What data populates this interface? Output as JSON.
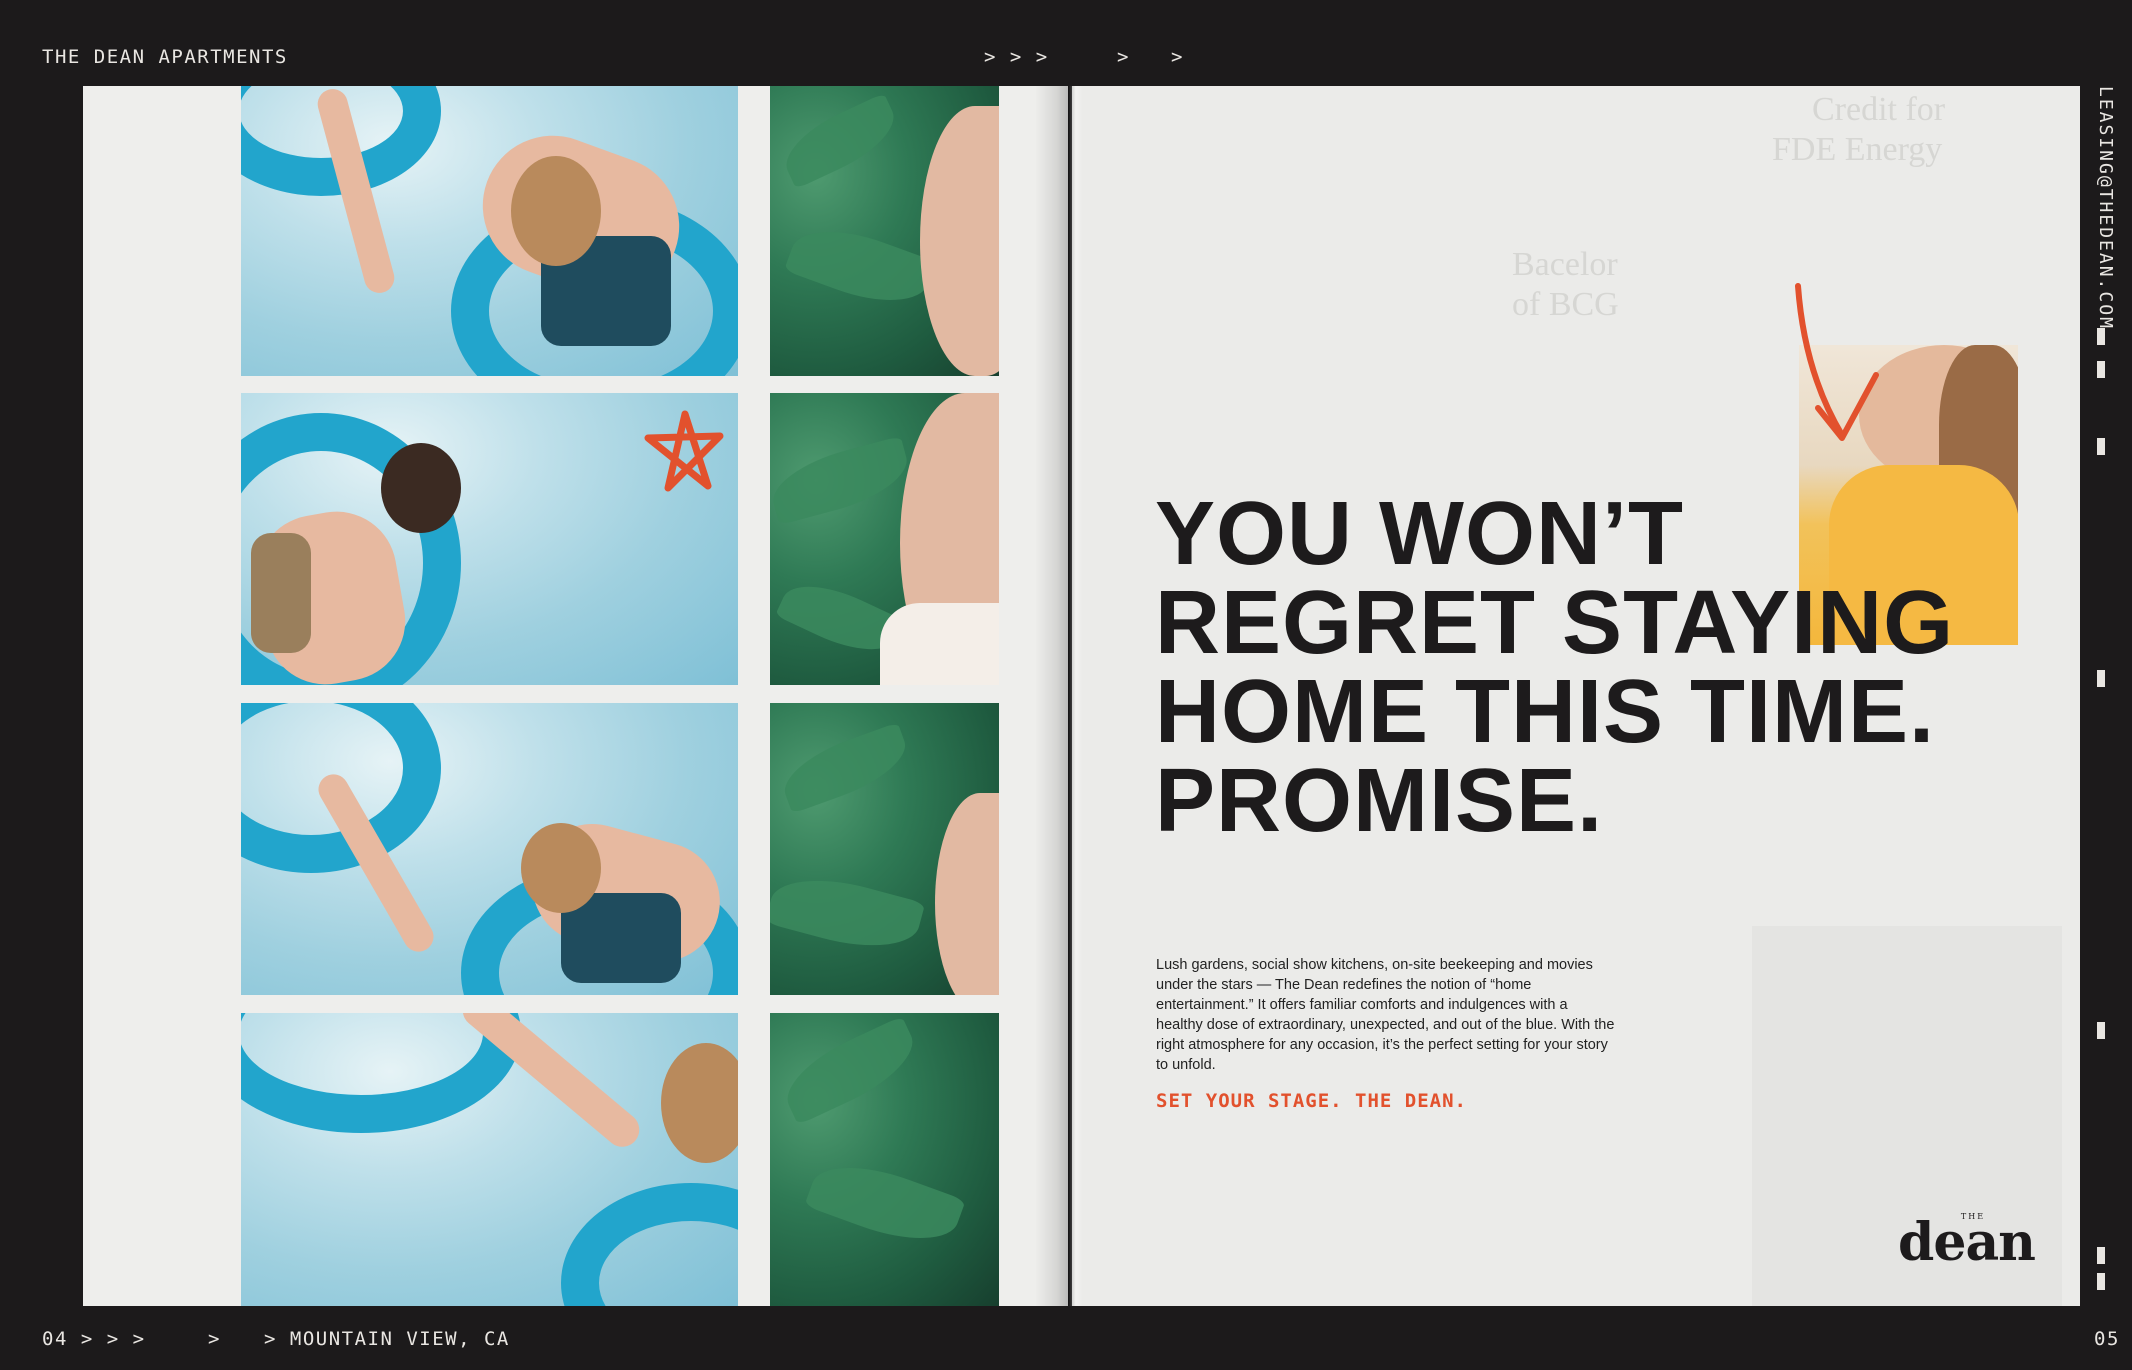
{
  "header": {
    "left_title": "THE DEAN APARTMENTS",
    "arrows_1": "> > >",
    "arrows_2": ">",
    "arrows_3": ">"
  },
  "footer": {
    "left_page": "04 > > >",
    "arrow_mid": ">",
    "location": "> MOUNTAIN VIEW, CA",
    "right_page": "05"
  },
  "sidebar": {
    "email": "LEASING@THEDEAN.COM"
  },
  "headline": [
    "YOU WON’T",
    "REGRET STAYING",
    "HOME THIS TIME.",
    "PROMISE."
  ],
  "body_copy": "Lush gardens, social show kitchens, on-site beekeeping and movies under the stars — The Dean redefines the notion of “home entertainment.” It offers familiar comforts and indulgences with a healthy dose of extraordinary, unexpected, and out of the blue. With the right atmosphere for any occasion, it’s the perfect setting for your story to unfold.",
  "tagline": "SET YOUR STAGE. THE DEAN.",
  "logo": {
    "small": "THE",
    "name": "dean"
  },
  "colors": {
    "accent": "#e2512d",
    "frame": "#1c1a1b",
    "paper": "#ecebe9",
    "ink": "#1d1b1c"
  },
  "icons": {
    "star": "star-doodle-icon",
    "arrow": "arrow-doodle-icon"
  }
}
